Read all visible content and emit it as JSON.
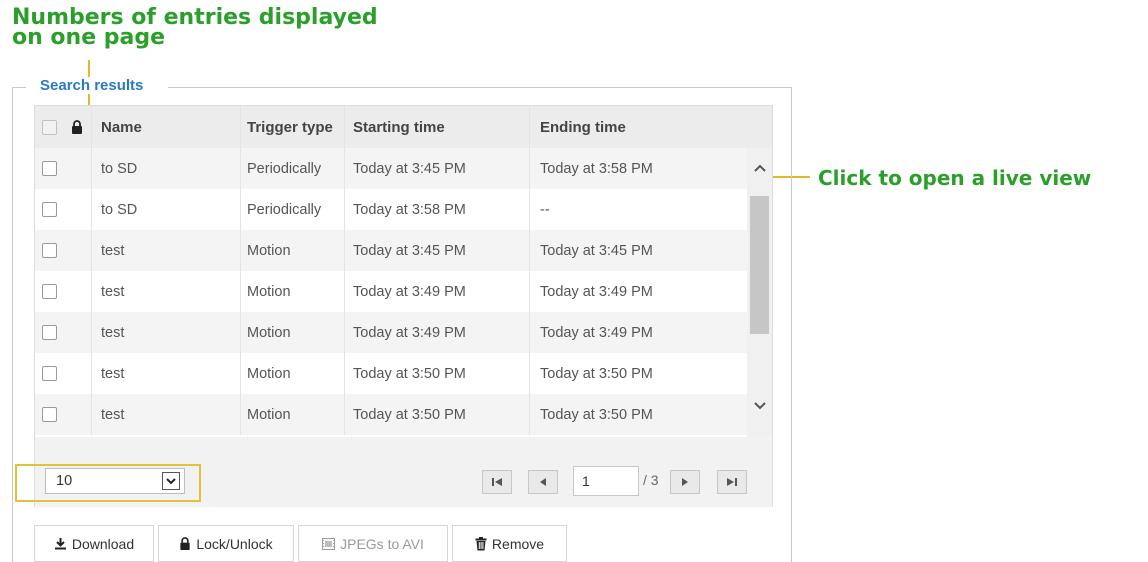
{
  "annotations": {
    "entries_per_page_line1": "Numbers of entries displayed",
    "entries_per_page_line2": "on one page",
    "live_view": "Click to open a live view"
  },
  "panel": {
    "legend": "Search results"
  },
  "table": {
    "headers": {
      "name": "Name",
      "trigger": "Trigger type",
      "start": "Starting time",
      "end": "Ending time"
    },
    "rows": [
      {
        "name": "to SD",
        "trigger": "Periodically",
        "start": "Today at 3:45 PM",
        "end": "Today at 3:58 PM"
      },
      {
        "name": "to SD",
        "trigger": "Periodically",
        "start": "Today at 3:58 PM",
        "end": "--"
      },
      {
        "name": "test",
        "trigger": "Motion",
        "start": "Today at 3:45 PM",
        "end": "Today at 3:45 PM"
      },
      {
        "name": "test",
        "trigger": "Motion",
        "start": "Today at 3:49 PM",
        "end": "Today at 3:49 PM"
      },
      {
        "name": "test",
        "trigger": "Motion",
        "start": "Today at 3:49 PM",
        "end": "Today at 3:49 PM"
      },
      {
        "name": "test",
        "trigger": "Motion",
        "start": "Today at 3:50 PM",
        "end": "Today at 3:50 PM"
      },
      {
        "name": "test",
        "trigger": "Motion",
        "start": "Today at 3:50 PM",
        "end": "Today at 3:50 PM"
      }
    ]
  },
  "pagination": {
    "per_page": "10",
    "current_page": "1",
    "total_label": "/ 3"
  },
  "actions": {
    "download": "Download",
    "lock_unlock": "Lock/Unlock",
    "jpegs_to_avi": "JPEGs to AVI",
    "remove": "Remove"
  },
  "colors": {
    "annotation_green": "#2aa02a",
    "highlight_yellow": "#e2c23a",
    "legend_blue": "#2b7bc0"
  }
}
